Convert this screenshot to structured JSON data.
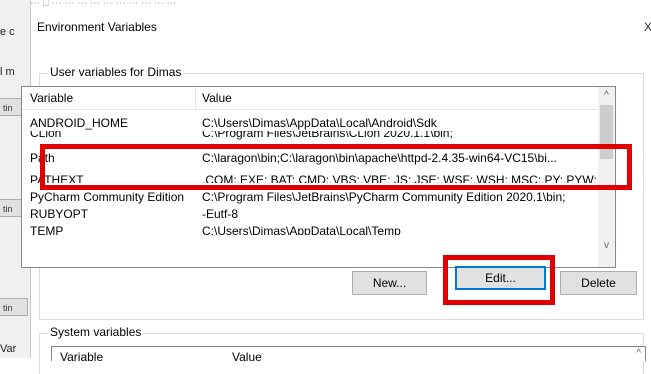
{
  "background": {
    "top_text": "⋯ ⎕ ⋯ ⋯ ⋯ ⋯ ⋯ ⋯ ⋯ ⋯ ⋯ ⋯",
    "side_labels": [
      "e c",
      "l m",
      "tin",
      "tin",
      "tin",
      "Var"
    ]
  },
  "dialog": {
    "title": "Environment Variables",
    "close_glyph": "X"
  },
  "user_vars": {
    "group_title": "User variables for Dimas",
    "columns": [
      "Variable",
      "Value"
    ],
    "rows": [
      {
        "name": "ANDROID_HOME",
        "value": "C:\\Users\\Dimas\\AppData\\Local\\Android\\Sdk"
      },
      {
        "name": "CLion",
        "value": "C:\\Program Files\\JetBrains\\CLion 2020.1.1\\bin;"
      },
      {
        "name": "Path",
        "value": "C:\\laragon\\bin;C:\\laragon\\bin\\apache\\httpd-2.4.35-win64-VC15\\bi..."
      },
      {
        "name": "PATHEXT",
        "value": ".COM;.EXE;.BAT;.CMD;.VBS;.VBE;.JS;.JSE;.WSF;.WSH;.MSC;.PY;.PYW;"
      },
      {
        "name": "PyCharm Community Edition",
        "value": "C:\\Program Files\\JetBrains\\PyCharm Community Edition 2020.1\\bin;"
      },
      {
        "name": "RUBYOPT",
        "value": "-Eutf-8"
      },
      {
        "name": "TEMP",
        "value": "C:\\Users\\Dimas\\AppData\\Local\\Temp"
      }
    ],
    "scroll_up": "^",
    "scroll_down": "v"
  },
  "buttons": {
    "new": "New...",
    "edit": "Edit...",
    "delete": "Delete"
  },
  "system_vars": {
    "group_title": "System variables",
    "columns": [
      "Variable",
      "Value"
    ],
    "scroll_up": "^"
  },
  "highlight_color": "#e00000"
}
